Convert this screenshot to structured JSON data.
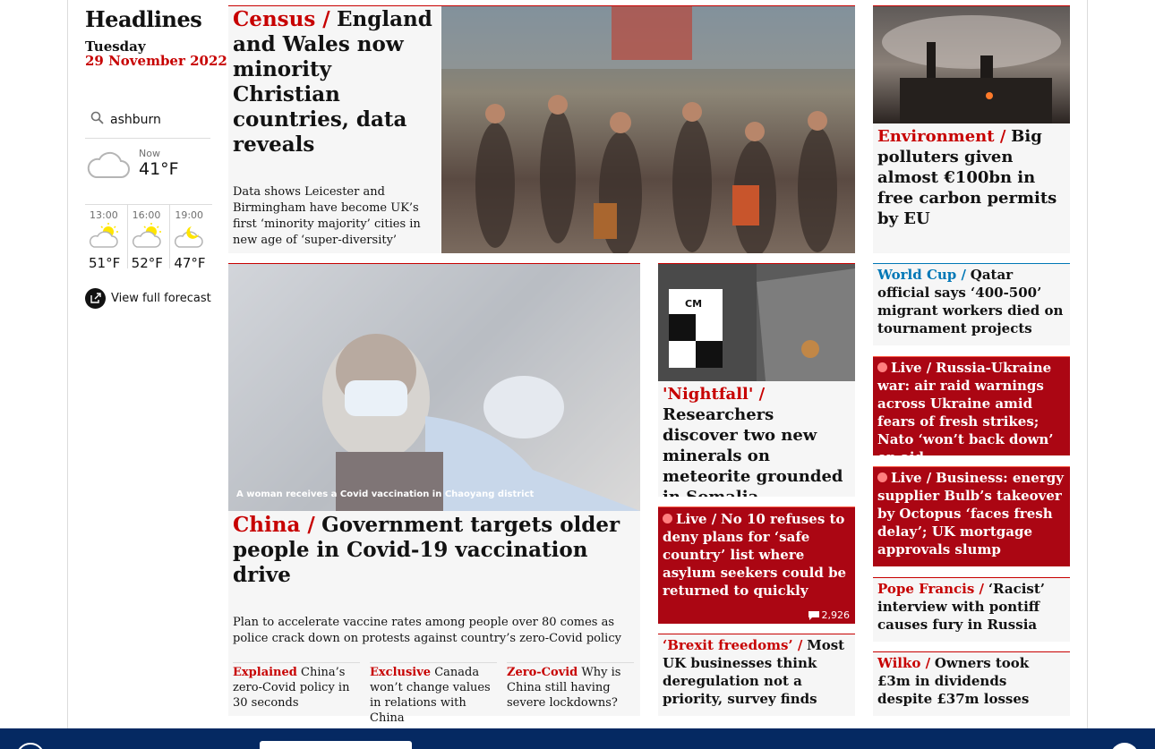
{
  "section": {
    "title": "Headlines",
    "day": "Tuesday",
    "date": "29 November 2022"
  },
  "weather": {
    "location": "ashburn",
    "now_label": "Now",
    "now_temp": "41°F",
    "forecast": [
      {
        "time": "13:00",
        "temp": "51°F",
        "icon": "sun-cloud-icon"
      },
      {
        "time": "16:00",
        "temp": "52°F",
        "icon": "sun-cloud-icon"
      },
      {
        "time": "19:00",
        "temp": "47°F",
        "icon": "moon-cloud-icon"
      }
    ],
    "full_forecast": "View full forecast"
  },
  "stories": {
    "lead": {
      "kicker": "Census /",
      "headline": "England and Wales now minority Christian countries, data reveals",
      "standfirst": "Data shows Leicester and Birmingham have become UK’s first ‘minority majority’ cities in new age of ‘super-diversity’"
    },
    "environment": {
      "kicker": "Environment /",
      "headline": "Big polluters given almost €100bn in free carbon permits by EU"
    },
    "worldcup": {
      "kicker": "World Cup /",
      "headline": "Qatar official says ‘400-500’ migrant workers died on tournament projects"
    },
    "ukraine": {
      "kicker": "Live /",
      "headline": "Russia-Ukraine war: air raid warnings across Ukraine amid fears of fresh strikes; Nato ‘won’t back down’ on aid"
    },
    "business": {
      "kicker": "Live /",
      "headline": "Business: energy supplier Bulb’s takeover by Octopus ‘faces fresh delay’; UK mortgage approvals slump"
    },
    "pope": {
      "kicker": "Pope Francis /",
      "headline": "‘Racist’ interview with pontiff causes fury in Russia"
    },
    "wilko": {
      "kicker": "Wilko /",
      "headline": "Owners took £3m in dividends despite £37m losses"
    },
    "china": {
      "kicker": "China /",
      "headline": "Government targets older people in Covid-19 vaccination drive",
      "standfirst": "Plan to accelerate vaccine rates among people over 80 comes as police crack down on protests against country’s zero-Covid policy",
      "caption": "A woman receives a Covid vaccination in Chaoyang district"
    },
    "sub1": {
      "kicker": "Explained",
      "headline": "China’s zero-Covid policy in 30 seconds"
    },
    "sub2": {
      "kicker": "Exclusive",
      "headline": "Canada won’t change values in relations with China"
    },
    "sub3": {
      "kicker": "Zero-Covid",
      "headline": "Why is China still having severe lockdowns?"
    },
    "nightfall": {
      "kicker": "'Nightfall' /",
      "headline": "Researchers discover two new minerals on meteorite grounded in Somalia",
      "scale_label": "CM"
    },
    "asylum": {
      "kicker": "Live /",
      "headline": "No 10 refuses to deny plans for ‘safe country’ list where asylum seekers could be returned to quickly",
      "comments": "2,926"
    },
    "brexit": {
      "kicker": "‘Brexit freedoms’ /",
      "headline": "Most UK businesses think deregulation not a priority, survey finds"
    }
  },
  "colors": {
    "news_red": "#c70000",
    "live_red": "#ab0613",
    "sport_blue": "#0077b6",
    "brand_navy": "#052962"
  }
}
